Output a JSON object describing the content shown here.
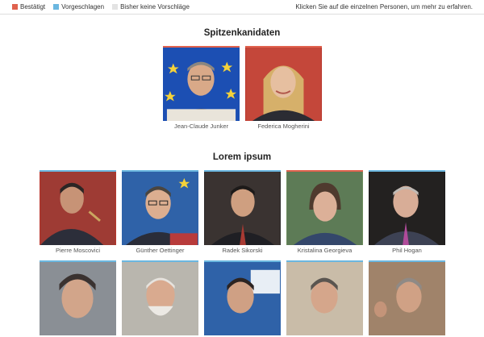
{
  "legend": [
    {
      "label": "Bestätigt",
      "color": "#e0624e"
    },
    {
      "label": "Vorgeschlagen",
      "color": "#6bb7e0"
    },
    {
      "label": "Bisher keine Vorschläge",
      "color": "#e3e3e3"
    }
  ],
  "hint": "Klicken Sie auf die einzelnen Personen, um mehr zu erfahren.",
  "sections": {
    "top": {
      "title": "Spitzenkanidaten"
    },
    "main": {
      "title": "Lorem ipsum"
    }
  },
  "top_people": [
    {
      "name": "Jean-Claude Junker",
      "status": "Bestätigt"
    },
    {
      "name": "Federica Mogherini",
      "status": "Bestätigt"
    }
  ],
  "people": [
    {
      "name": "Pierre Moscovici",
      "status": "Vorgeschlagen"
    },
    {
      "name": "Günther Oettinger",
      "status": "Vorgeschlagen"
    },
    {
      "name": "Radek Sikorski",
      "status": "Vorgeschlagen"
    },
    {
      "name": "Kristalina Georgieva",
      "status": "Bestätigt"
    },
    {
      "name": "Phil Hogan",
      "status": "Vorgeschlagen"
    },
    {
      "name": "",
      "status": "Vorgeschlagen"
    },
    {
      "name": "",
      "status": "Vorgeschlagen"
    },
    {
      "name": "",
      "status": "Vorgeschlagen"
    },
    {
      "name": "",
      "status": "Vorgeschlagen"
    },
    {
      "name": "",
      "status": "Vorgeschlagen"
    }
  ]
}
